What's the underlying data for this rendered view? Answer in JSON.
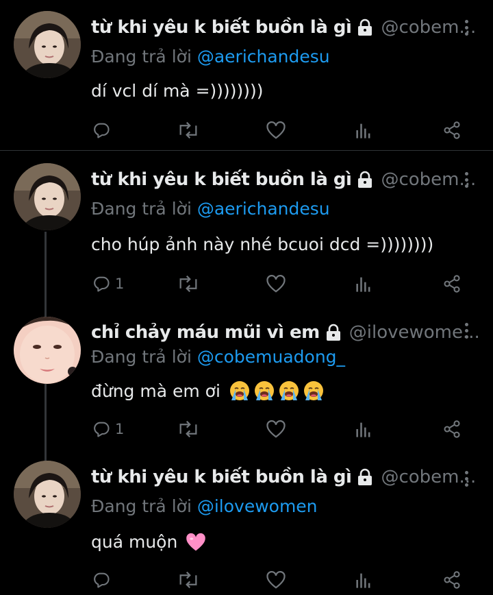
{
  "colors": {
    "background": "#000000",
    "text": "#e7e9ea",
    "muted": "#71767b",
    "accent": "#1d9bf0",
    "divider": "#2f3336"
  },
  "tweets": [
    {
      "display_name": "từ khi yêu k biết buồn là gì",
      "handle": "@cobem...",
      "reply_prefix": "Đang trả lời",
      "reply_to": "@aerichandesu",
      "text": "dí vcl dí mà =))))))))",
      "emojis": [],
      "reply_count": "",
      "icons": [
        "lock-icon",
        "more-icon",
        "reply-icon",
        "retweet-icon",
        "like-icon",
        "analytics-icon",
        "share-icon"
      ]
    },
    {
      "display_name": "từ khi yêu k biết buồn là gì",
      "handle": "@cobem...",
      "reply_prefix": "Đang trả lời",
      "reply_to": "@aerichandesu",
      "text": "cho húp ảnh này nhé bcuoi dcd =))))))))",
      "emojis": [],
      "reply_count": "1",
      "icons": [
        "lock-icon",
        "more-icon",
        "reply-icon",
        "retweet-icon",
        "like-icon",
        "analytics-icon",
        "share-icon"
      ]
    },
    {
      "display_name": "chỉ chảy máu mũi vì em",
      "handle": "@ilovewome...",
      "reply_prefix": "Đang trả lời",
      "reply_to": "@cobemuadong_",
      "text": "đừng mà em ơi",
      "emojis": [
        "loudly-crying-face",
        "loudly-crying-face",
        "loudly-crying-face",
        "loudly-crying-face"
      ],
      "reply_count": "1",
      "icons": [
        "lock-icon",
        "more-icon",
        "reply-icon",
        "retweet-icon",
        "like-icon",
        "analytics-icon",
        "share-icon"
      ]
    },
    {
      "display_name": "từ khi yêu k biết buồn là gì",
      "handle": "@cobem...",
      "reply_prefix": "Đang trả lời",
      "reply_to": "@ilovewomen",
      "text": "quá muộn",
      "emojis": [
        "pink-heart"
      ],
      "reply_count": "",
      "icons": [
        "lock-icon",
        "more-icon",
        "reply-icon",
        "retweet-icon",
        "like-icon",
        "analytics-icon",
        "share-icon"
      ]
    }
  ]
}
